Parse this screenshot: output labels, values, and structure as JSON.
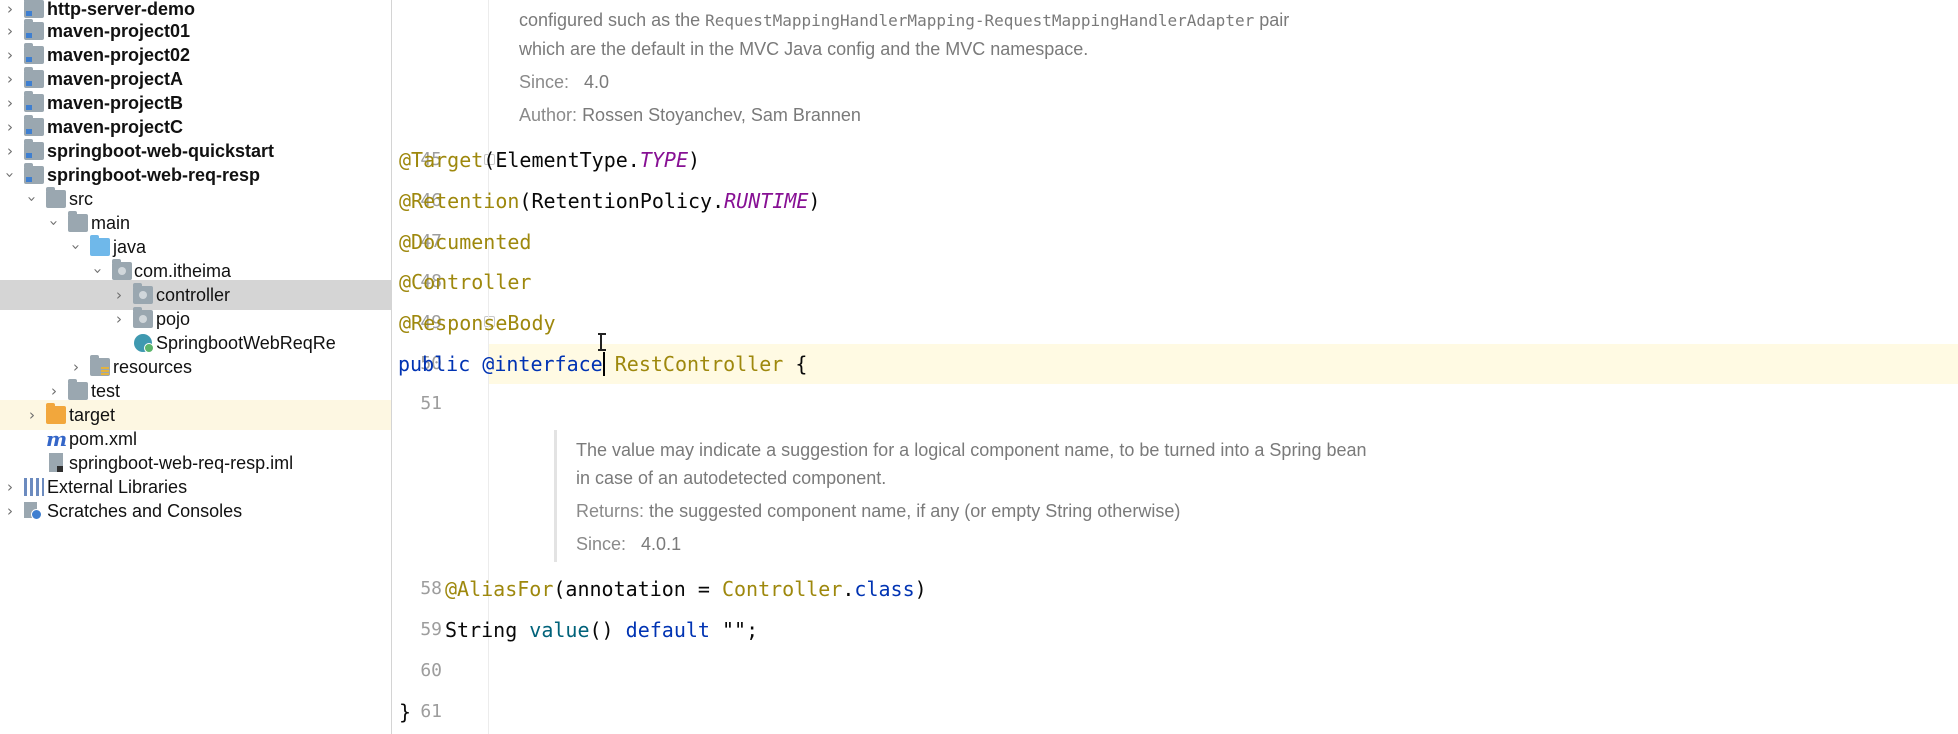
{
  "tree": {
    "items": [
      {
        "label": "http-server-demo",
        "bold": true
      },
      {
        "label": "maven-project01",
        "bold": true
      },
      {
        "label": "maven-project02",
        "bold": true
      },
      {
        "label": "maven-projectA",
        "bold": true
      },
      {
        "label": "maven-projectB",
        "bold": true
      },
      {
        "label": "maven-projectC",
        "bold": true
      },
      {
        "label": "springboot-web-quickstart",
        "bold": true
      },
      {
        "label": "springboot-web-req-resp",
        "bold": true
      },
      {
        "label": "src"
      },
      {
        "label": "main"
      },
      {
        "label": "java"
      },
      {
        "label": "com.itheima"
      },
      {
        "label": "controller"
      },
      {
        "label": "pojo"
      },
      {
        "label": "SpringbootWebReqRe"
      },
      {
        "label": "resources"
      },
      {
        "label": "test"
      },
      {
        "label": "target"
      },
      {
        "label": "pom.xml"
      },
      {
        "label": "springboot-web-req-resp.iml"
      },
      {
        "label": "External Libraries"
      },
      {
        "label": "Scratches and Consoles"
      }
    ],
    "icons": {
      "module": "module-folder-icon",
      "folder": "folder-icon",
      "source": "source-folder-icon",
      "package": "package-icon",
      "class": "spring-boot-class-icon",
      "resources": "resources-folder-icon",
      "excluded": "excluded-folder-icon",
      "maven": "maven-icon",
      "iml": "iml-file-icon",
      "libraries": "libraries-icon",
      "scratches": "scratches-icon"
    }
  },
  "editor": {
    "doc_top": {
      "line1_text": "configured such as the",
      "line1_code": "RequestMappingHandlerMapping-RequestMappingHandlerAdapter",
      "line1_tail": "pair",
      "line2": "which are the default in the MVC Java config and the MVC namespace.",
      "since_label": "Since:",
      "since_value": "4.0",
      "author_label": "Author:",
      "author_value": "Rossen Stoyanchev, Sam Brannen"
    },
    "lines": {
      "l45": {
        "num": "45",
        "ann": "@Target",
        "p1": "(ElementType.",
        "fld": "TYPE",
        "p2": ")"
      },
      "l46": {
        "num": "46",
        "ann": "@Retention",
        "p1": "(RetentionPolicy.",
        "fld": "RUNTIME",
        "p2": ")"
      },
      "l47": {
        "num": "47",
        "ann": "@Documented"
      },
      "l48": {
        "num": "48",
        "ann": "@Controller"
      },
      "l49": {
        "num": "49",
        "ann": "@ResponseBody"
      },
      "l50": {
        "num": "50",
        "kw": "public",
        "ann_kw": "@interface",
        "name": "RestController",
        "brace": "{"
      },
      "l51": {
        "num": "51"
      },
      "l58": {
        "num": "58",
        "ann": "@AliasFor",
        "p1": "(annotation = ",
        "cls": "Controller",
        "dot": ".",
        "kw": "class",
        "p2": ")"
      },
      "l59": {
        "num": "59",
        "type": "String",
        "method": "value",
        "parens": "()",
        "kw": "default",
        "str": "\"\";"
      },
      "l60": {
        "num": "60"
      },
      "l61": {
        "num": "61",
        "brace": "}"
      }
    },
    "doc_mid": {
      "line1": "The value may indicate a suggestion for a logical component name, to be turned into a Spring bean",
      "line2": "in case of an autodetected component.",
      "returns_label": "Returns:",
      "returns_value": "the suggested component name, if any (or empty String otherwise)",
      "since_label": "Since:",
      "since_value": "4.0.1"
    }
  }
}
